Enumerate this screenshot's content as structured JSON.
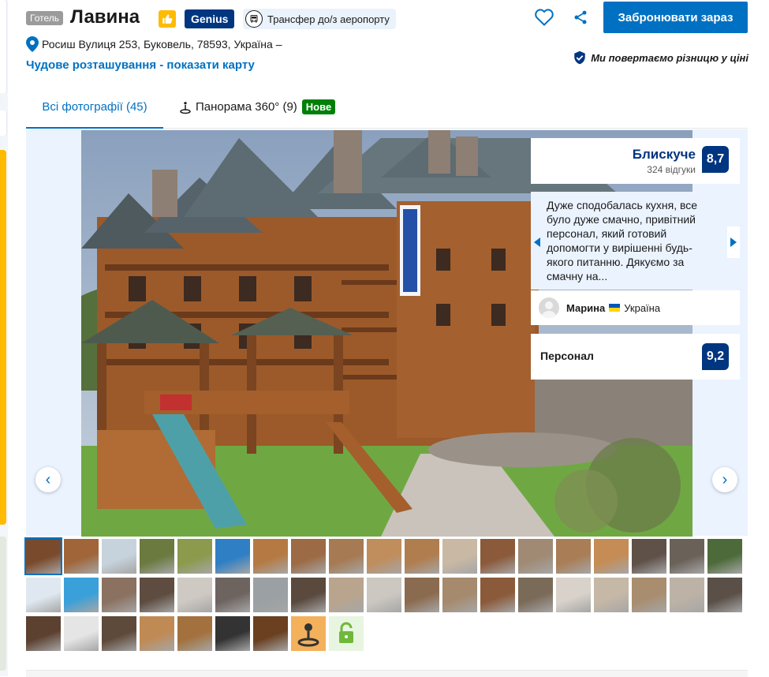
{
  "header": {
    "type_badge": "Готель",
    "hotel_name": "Лавина",
    "genius_label": "Genius",
    "transfer_label": "Трансфер до/з аеропорту",
    "address": "Росиш Вулиця 253, Буковель, 78593, Україна –",
    "map_link": "Чудове розташування - показати карту",
    "book_button": "Забронювати зараз",
    "price_match": "Ми повертаємо різницю у ціні"
  },
  "tabs": {
    "all_photos": "Всі фотографії (45)",
    "panorama": "Панорама 360° (9)",
    "new_badge": "Нове"
  },
  "review": {
    "score_word": "Блискуче",
    "review_count": "324 відгуки",
    "score": "8,7",
    "quote": "Дуже сподобалась кухня, все було дуже смачно, привітний персонал, який готовий допомогти у вирішенні будь-якого питанню. Дякуємо за смачну на...",
    "reviewer_name": "Марина",
    "reviewer_country": "Україна",
    "staff_label": "Персонал",
    "staff_score": "9,2"
  },
  "gallery": {
    "prev_arrow": "‹",
    "next_arrow": "›"
  },
  "icons": {
    "thumbs_up": "thumbs-up-icon",
    "bus": "bus-icon",
    "heart": "heart-icon",
    "share": "share-icon",
    "pin": "map-pin-icon",
    "shield": "shield-check-icon",
    "panorama": "panorama-360-icon"
  },
  "colors": {
    "primary_blue": "#0071c2",
    "dark_blue": "#003580",
    "genius_yellow": "#febb02",
    "new_green": "#008009"
  },
  "thumbnails": {
    "count": 45,
    "colors": [
      "#7a4a2c",
      "#a0663a",
      "#c7d3dc",
      "#6b7a3f",
      "#8b9a4c",
      "#2f7fc4",
      "#b57a43",
      "#9c6a44",
      "#a67a52",
      "#c08d5d",
      "#b07d4f",
      "#c9b9a4",
      "#8b5a3a",
      "#a08a74",
      "#a97d55",
      "#c58c55",
      "#5f5048",
      "#6a6158",
      "#4d6b3a",
      "#dfe8f0",
      "#3aa0d9",
      "#8a7160",
      "#5e4c40",
      "#cfc9c3",
      "#6d6460",
      "#9aa0a3",
      "#5a4a3e",
      "#b9a58e",
      "#ccc7c1",
      "#8b6b4f",
      "#a58a6d",
      "#8a5a3a",
      "#7a6a58",
      "#d8d2ca",
      "#c6b8a6",
      "#a88d6f",
      "#bcb2a6",
      "#5a5048",
      "#5c4030",
      "#e5e5e5",
      "#5e4a3a",
      "#c08a55",
      "#a3713d",
      "#333333",
      "#6a4020",
      "#c48a35",
      "#f3b15b",
      "#6fb83a"
    ]
  }
}
